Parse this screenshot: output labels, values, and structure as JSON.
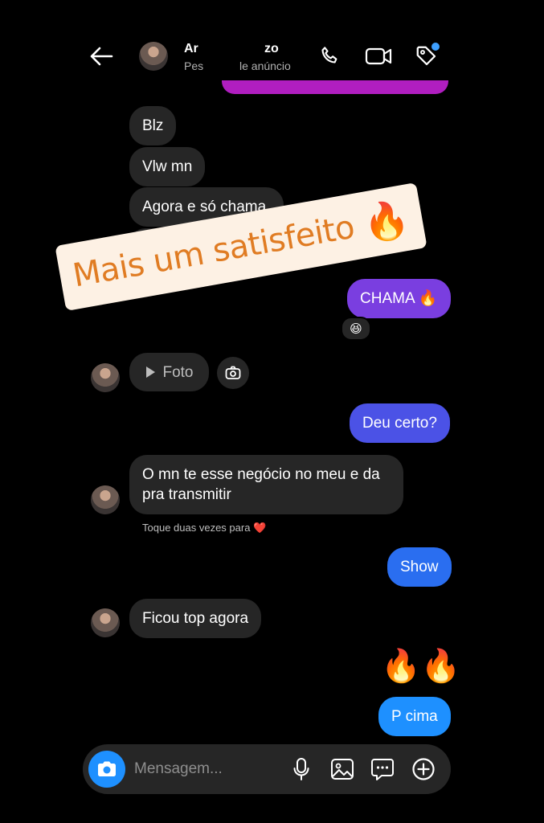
{
  "header": {
    "name_left": "Ar",
    "sub_left": "Pes",
    "name_right": "zo",
    "sub_right": "le anúncio"
  },
  "sticker": {
    "text": "Mais um satisfeito",
    "emoji": "🔥"
  },
  "messages": {
    "m1": "Blz",
    "m2": "Vlw mn",
    "m3": "Agora e só chama",
    "m4": "CHAMA 🔥",
    "m4_reaction": "😆",
    "m5_label": "Foto",
    "m6": "Deu certo?",
    "m7_line1": "O mn te esse negócio no meu e da",
    "m7_line2": "pra transmitir",
    "m7_hint": "Toque duas vezes para ❤️",
    "m8": "Show",
    "m9": "Ficou top agora",
    "m10_emoji": "🔥🔥",
    "m11": "P cima"
  },
  "composer": {
    "placeholder": "Mensagem..."
  },
  "colors": {
    "accent_blue": "#1e90ff",
    "bubble_purple": "#7a3ee0",
    "bubble_indigo": "#4b52e6",
    "bubble_blue": "#2a6ef0",
    "bubble_received": "#262626"
  }
}
